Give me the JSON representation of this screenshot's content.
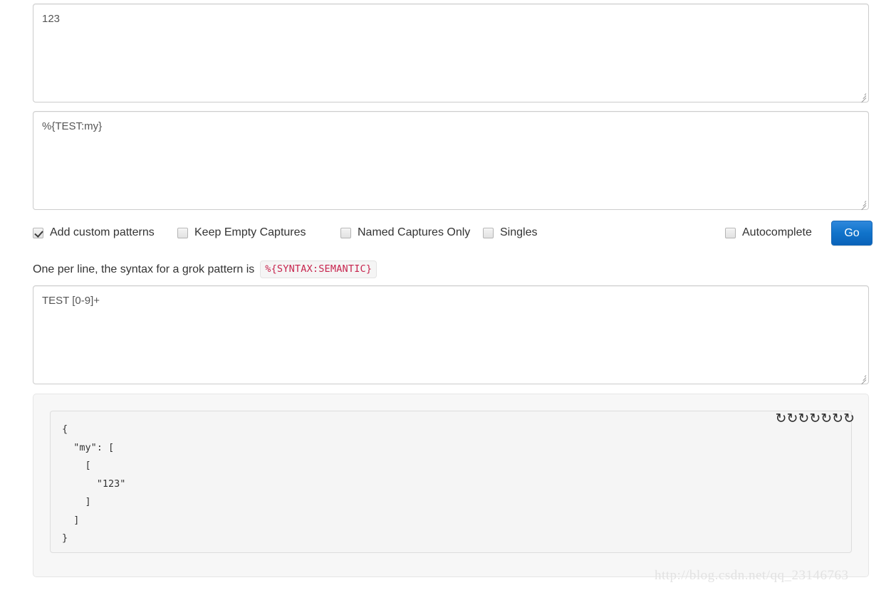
{
  "input_textarea": {
    "value": "123",
    "placeholder": ""
  },
  "pattern_textarea": {
    "value": "%{TEST:my}",
    "placeholder": ""
  },
  "custom_patterns_textarea": {
    "value": "TEST [0-9]+",
    "placeholder": ""
  },
  "options": {
    "add_custom_patterns": {
      "label": "Add custom patterns",
      "checked": true
    },
    "keep_empty_captures": {
      "label": "Keep Empty Captures",
      "checked": false
    },
    "named_captures_only": {
      "label": "Named Captures Only",
      "checked": false
    },
    "singles": {
      "label": "Singles",
      "checked": false
    },
    "autocomplete": {
      "label": "Autocomplete",
      "checked": false
    },
    "go_button_label": "Go"
  },
  "help": {
    "text": "One per line, the syntax for a grok pattern is",
    "code": "%{SYNTAX:SEMANTIC}"
  },
  "result": {
    "json_output": "{\n  \"my\": [\n    [\n      \"123\"\n    ]\n  ]\n}",
    "spinner_glyph": "↻",
    "spinner_count": 7
  },
  "watermark": {
    "text": "http://blog.csdn.net/qq_23146763"
  },
  "colors": {
    "accent_blue": "#1174cb",
    "code_red": "#c7254e",
    "border_gray": "#cccccc",
    "panel_bg": "#f7f7f7",
    "pre_bg": "#f5f5f5",
    "watermark_gray": "#e2e2e2"
  }
}
